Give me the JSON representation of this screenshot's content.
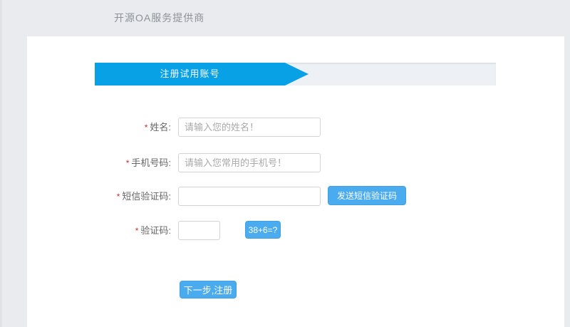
{
  "header": {
    "brand": "开源OA服务提供商"
  },
  "banner": {
    "title": "注册试用账号"
  },
  "form": {
    "fields": [
      {
        "required": "*",
        "label": "姓名:",
        "placeholder": "请输入您的姓名！",
        "value": ""
      },
      {
        "required": "*",
        "label": "手机号码:",
        "placeholder": "请输入您常用的手机号！",
        "value": ""
      },
      {
        "required": "*",
        "label": "短信验证码:",
        "placeholder": "",
        "value": "",
        "button": "发送短信验证码"
      },
      {
        "required": "*",
        "label": "验证码:",
        "placeholder": "",
        "value": "",
        "captcha_button": "38+6=?"
      }
    ],
    "submit_label": "下一步,注册"
  },
  "colors": {
    "page_background": "#e9ebee",
    "card_background": "#ffffff",
    "banner_bar": "#edf1f5",
    "ribbon_blue": "#09a1e5",
    "button_blue": "#4aabee",
    "required_red": "#c9302c",
    "label_text": "#666666",
    "placeholder_text": "#a9a9a9"
  }
}
